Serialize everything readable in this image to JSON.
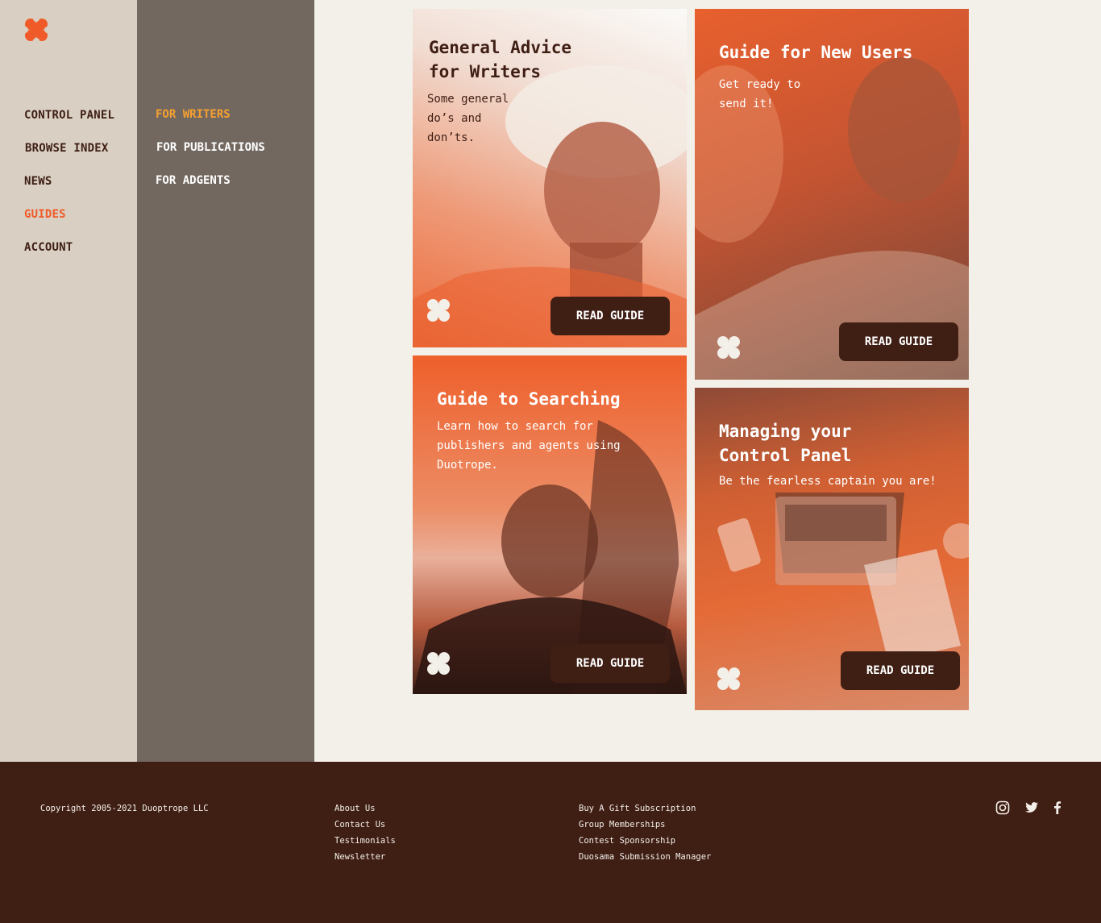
{
  "nav_primary": {
    "items": [
      {
        "label": "CONTROL PANEL",
        "active": false
      },
      {
        "label": "BROWSE INDEX",
        "active": false
      },
      {
        "label": "NEWS",
        "active": false
      },
      {
        "label": "GUIDES",
        "active": true
      },
      {
        "label": "ACCOUNT",
        "active": false
      }
    ]
  },
  "nav_secondary": {
    "items": [
      {
        "label": "FOR WRITERS",
        "active": true
      },
      {
        "label": "FOR PUBLICATIONS",
        "active": false
      },
      {
        "label": "FOR ADGENTS",
        "active": false
      }
    ]
  },
  "cards": [
    {
      "title_line1": "General Advice",
      "title_line2": "for Writers",
      "desc_line1": "Some general",
      "desc_line2": "do’s and",
      "desc_line3": "don’ts.",
      "button": "READ GUIDE"
    },
    {
      "title_line1": "Guide for New Users",
      "desc_line1": "Get ready to",
      "desc_line2": "send it!",
      "button": "READ GUIDE"
    },
    {
      "title_line1": "Guide to Searching",
      "desc_line1": "Learn how to search for",
      "desc_line2": "publishers and agents using",
      "desc_line3": "Duotrope.",
      "button": "READ GUIDE"
    },
    {
      "title_line1": "Managing your",
      "title_line2": "Control Panel",
      "desc_line1": "Be the fearless captain you are!",
      "button": "READ GUIDE"
    }
  ],
  "footer": {
    "copyright": "Copyright 2005-2021 Duoptrope LLC",
    "links_col1": [
      "About Us",
      "Contact Us",
      "Testimonials",
      "Newsletter"
    ],
    "links_col2": [
      "Buy A Gift Subscription",
      "Group Memberships",
      "Contest Sponsorship",
      "Duosama Submission Manager"
    ],
    "social_icons": [
      "instagram-icon",
      "twitter-icon",
      "facebook-icon"
    ]
  },
  "colors": {
    "brand_orange": "#f05a28",
    "active_secondary": "#f6a030",
    "dark_brown": "#3f1e14",
    "nav_bg": "#d9d0c3",
    "subnav_bg": "#726860",
    "page_bg": "#f3efe9"
  }
}
